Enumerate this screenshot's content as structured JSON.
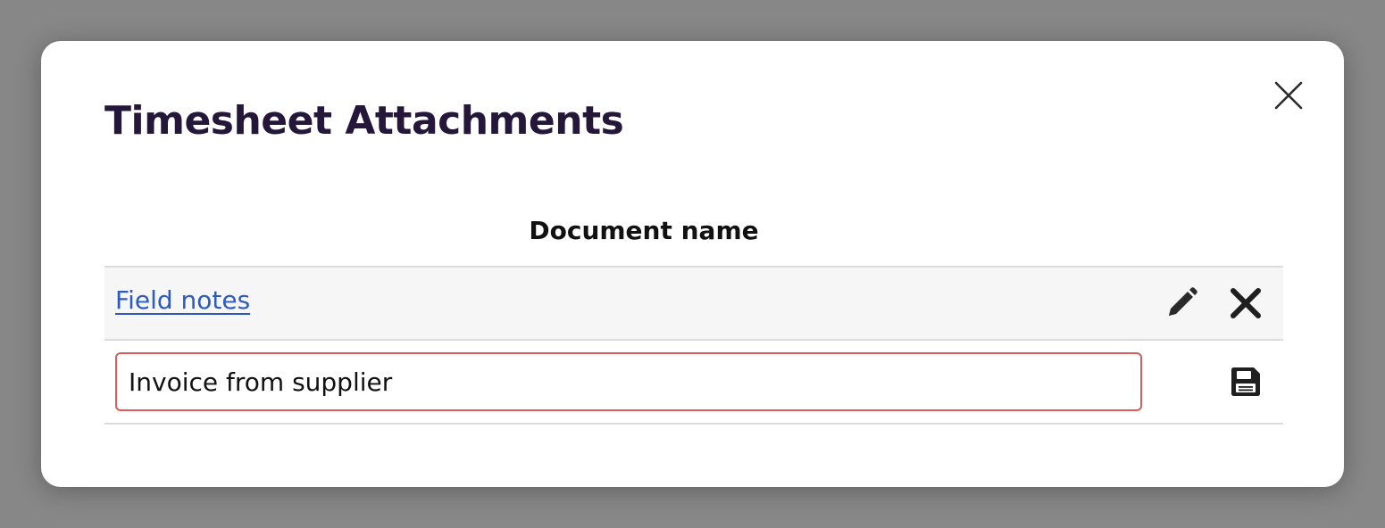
{
  "modal": {
    "title": "Timesheet Attachments",
    "close_icon": "close-icon"
  },
  "table": {
    "column_header": "Document name",
    "rows": [
      {
        "name": "Field notes",
        "mode": "view",
        "actions": [
          "pencil-icon",
          "close-icon"
        ]
      },
      {
        "name": "Invoice from supplier",
        "mode": "edit",
        "actions": [
          "save-icon"
        ]
      }
    ]
  },
  "colors": {
    "title": "#25173a",
    "link": "#2d5bbd",
    "input_border_error": "#df5a5a",
    "row_alt_background": "#f6f6f6",
    "overlay": "#878787"
  }
}
